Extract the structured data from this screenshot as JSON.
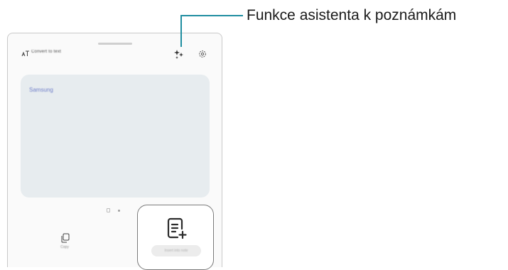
{
  "header": {
    "convert_label": "Convert to text"
  },
  "note": {
    "text": "Samsung"
  },
  "bottom_bar": {
    "copy_label": "Copy",
    "insert_label": "Insert into note"
  },
  "callout": {
    "text": "Funkce asistenta k poznámkám"
  },
  "icons": {
    "text_icon": "text-format-icon",
    "ai_icon": "sparkle-icon",
    "settings_icon": "gear-icon",
    "copy_icon": "copy-icon",
    "insert_icon": "note-add-icon"
  },
  "colors": {
    "accent": "#1f8ea0",
    "note_background": "#e7ecef",
    "note_text": "#6f7ec9"
  }
}
